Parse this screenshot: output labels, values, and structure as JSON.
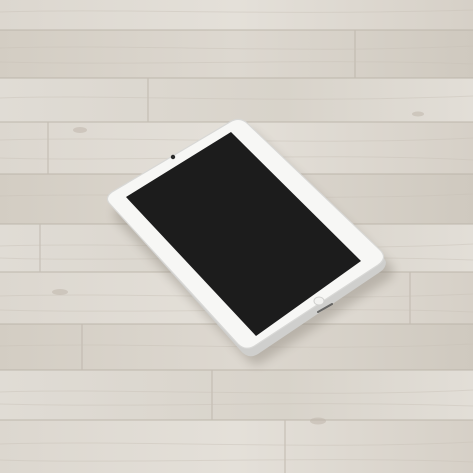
{
  "scene": {
    "subject": "tablet-on-wood-floor",
    "tablet_color": "white",
    "screen_state": "off"
  },
  "colors": {
    "floor_base": "#d9d4cc",
    "floor_light": "#e3dfd8",
    "floor_dark": "#cbc5bb",
    "plank_seam": "#b9b2a7",
    "bezel": "#f7f7f5",
    "bezel_edge": "#d8d8d6",
    "screen": "#1c1c1c",
    "shadow": "#8f887e"
  },
  "icons": {
    "camera": "front-camera-dot",
    "home_button": "home-button-circle"
  }
}
